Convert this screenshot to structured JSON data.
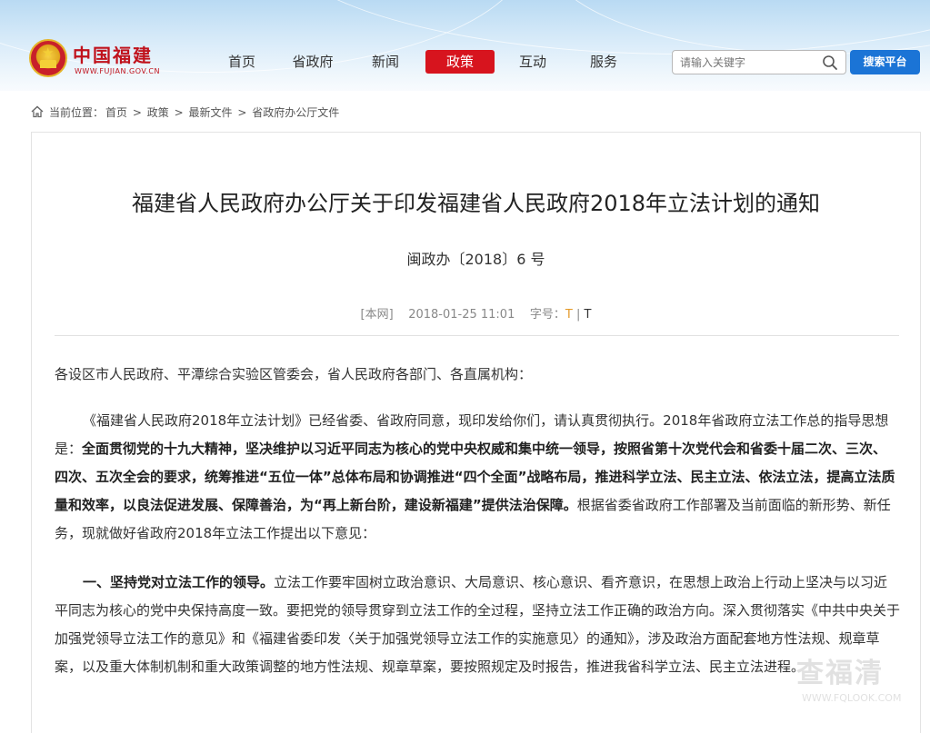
{
  "header": {
    "logo_title": "中国福建",
    "logo_subtitle": "WWW.FUJIAN.GOV.CN",
    "nav": [
      {
        "label": "首页"
      },
      {
        "label": "省政府"
      },
      {
        "label": "新闻"
      },
      {
        "label": "政策"
      },
      {
        "label": "互动"
      },
      {
        "label": "服务"
      }
    ],
    "active_nav": "政策",
    "search_placeholder": "请输入关键字",
    "search_button": "搜索平台",
    "colors": {
      "accent_red": "#d7141e",
      "search_blue": "#1b74d6"
    }
  },
  "breadcrumb": {
    "prefix": "当前位置：",
    "items": [
      "首页",
      "政策",
      "最新文件",
      "省政府办公厅文件"
    ],
    "separator": ">"
  },
  "article": {
    "title": "福建省人民政府办公厅关于印发福建省人民政府2018年立法计划的通知",
    "doc_number": "闽政办〔2018〕6 号",
    "source": "[本网]",
    "datetime": "2018-01-25 11:01",
    "font_size_label": "字号：",
    "font_large": "T",
    "font_sep": "|",
    "font_small": "T",
    "p1": "各设区市人民政府、平潭综合实验区管委会，省人民政府各部门、各直属机构：",
    "p2_a": "《福建省人民政府2018年立法计划》已经省委、省政府同意，现印发给你们，请认真贯彻执行。2018年省政府立法工作总的指导思想是：",
    "p2_bold": "全面贯彻党的十九大精神，坚决维护以习近平同志为核心的党中央权威和集中统一领导，按照省第十次党代会和省委十届二次、三次、四次、五次全会的要求，统筹推进“五位一体”总体布局和协调推进“四个全面”战略布局，推进科学立法、民主立法、依法立法，提高立法质量和效率，以良法促进发展、保障善治，为“再上新台阶，建设新福建”提供法治保障。",
    "p2_b": "根据省委省政府工作部署及当前面临的新形势、新任务，现就做好省政府2018年立法工作提出以下意见：",
    "p3_bold": "一、坚持党对立法工作的领导。",
    "p3": "立法工作要牢固树立政治意识、大局意识、核心意识、看齐意识，在思想上政治上行动上坚决与以习近平同志为核心的党中央保持高度一致。要把党的领导贯穿到立法工作的全过程，坚持立法工作正确的政治方向。深入贯彻落实《中共中央关于加强党领导立法工作的意见》和《福建省委印发〈关于加强党领导立法工作的实施意见〉的通知》，涉及政治方面配套地方性法规、规章草案，以及重大体制机制和重大政策调整的地方性法规、规章草案，要按照规定及时报告，推进我省科学立法、民主立法进程。"
  },
  "watermark": {
    "main": "查福清",
    "sub": "WWW.FQLOOK.COM"
  }
}
